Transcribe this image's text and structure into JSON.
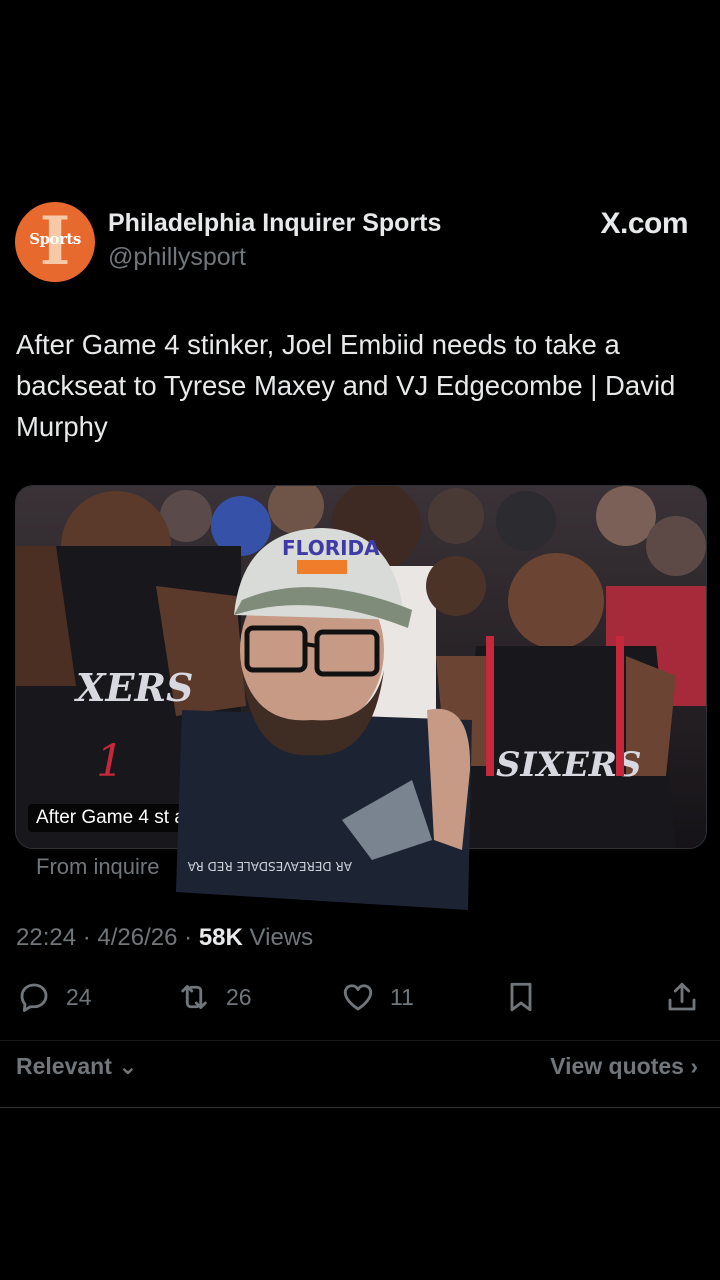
{
  "post": {
    "author": {
      "display_name": "Philadelphia Inquirer Sports",
      "handle": "@phillysport",
      "avatar_text": "Sports"
    },
    "brand": "X.com",
    "text": "After Game 4 stinker, Joel Embiid needs to take a backseat to Tyrese Maxey and VJ Edgecombe | David Murphy",
    "card": {
      "title_visible": "After Game 4 st                                        a backseat to Tyre…",
      "source": "From inquire"
    },
    "time": "22:24",
    "date": "4/26/26",
    "views_count": "58K",
    "views_label": "Views"
  },
  "actions": {
    "replies": "24",
    "reposts": "26",
    "likes": "11"
  },
  "replies_sort": {
    "label": "Relevant",
    "view_quotes": "View quotes"
  },
  "colors": {
    "avatar_bg": "#e8692e",
    "muted_text": "#71767b",
    "primary_text": "#e7e9ea"
  }
}
